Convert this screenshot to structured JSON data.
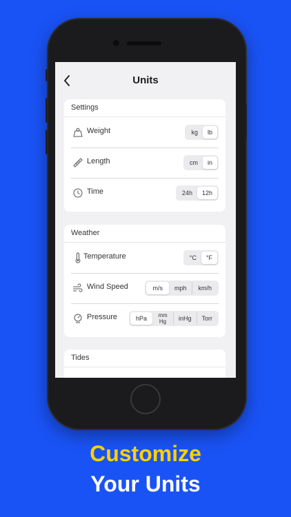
{
  "screen": {
    "title": "Units"
  },
  "settings": {
    "header": "Settings",
    "rows": [
      {
        "label": "Weight",
        "icon": "weight-icon",
        "options": [
          "kg",
          "lb"
        ],
        "selected": "lb"
      },
      {
        "label": "Length",
        "icon": "ruler-icon",
        "options": [
          "cm",
          "in"
        ],
        "selected": "in"
      },
      {
        "label": "Time",
        "icon": "clock-icon",
        "options": [
          "24h",
          "12h"
        ],
        "selected": "12h"
      }
    ]
  },
  "weather": {
    "header": "Weather",
    "rows": [
      {
        "label": "Temperature",
        "icon": "thermometer-icon",
        "options": [
          "°C",
          "°F"
        ],
        "selected": "°F"
      },
      {
        "label": "Wind Speed",
        "icon": "wind-icon",
        "options": [
          "m/s",
          "mph",
          "km/h"
        ],
        "selected": "m/s"
      },
      {
        "label": "Pressure",
        "icon": "pressure-icon",
        "options": [
          "hPa",
          "mmHg",
          "inHg",
          "Torr"
        ],
        "selected": "hPa"
      }
    ]
  },
  "tides": {
    "header": "Tides"
  },
  "caption": {
    "line1": "Customize",
    "line2": "Your Units"
  },
  "colors": {
    "background": "#1a53f5",
    "accent": "#ffd000"
  }
}
